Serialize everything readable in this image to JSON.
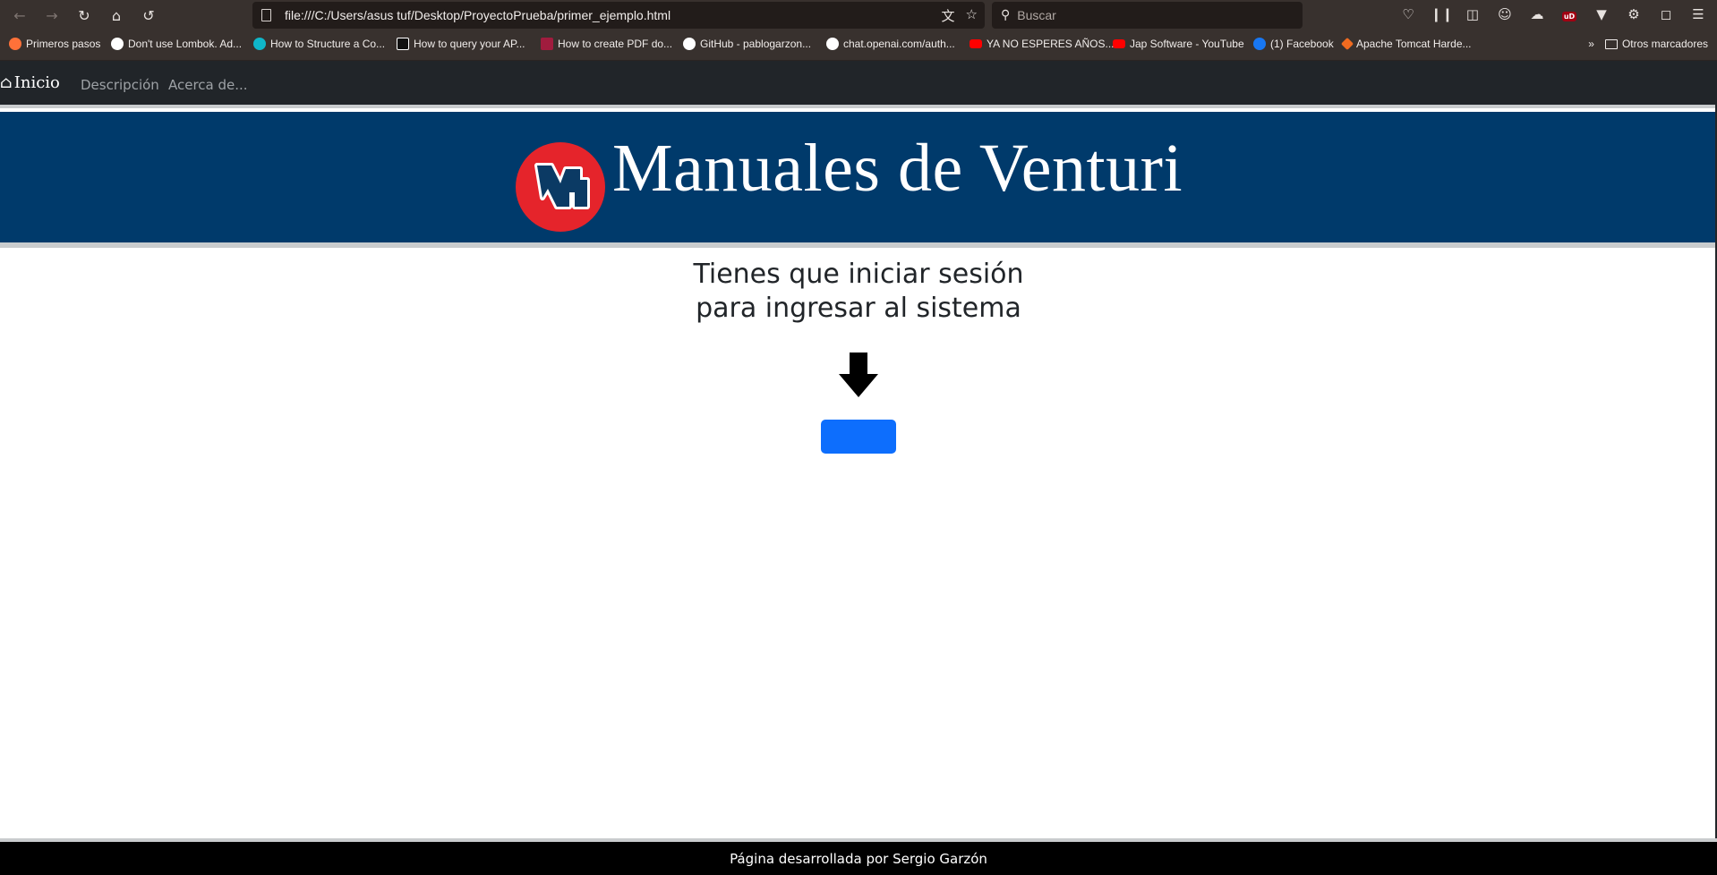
{
  "browser": {
    "url": "file:///C:/Users/asus tuf/Desktop/ProyectoPrueba/primer_ejemplo.html",
    "search_placeholder": "Buscar",
    "bookmarks": [
      {
        "label": "Primeros pasos",
        "color": "#ff7139"
      },
      {
        "label": "Don't use Lombok. Ad...",
        "color": "#ffffff"
      },
      {
        "label": "How to Structure a Co...",
        "color": "#0fb6c9"
      },
      {
        "label": "How to query your AP...",
        "color": "#000000"
      },
      {
        "label": "How to create PDF do...",
        "color": "#a01c3e"
      },
      {
        "label": "GitHub - pablogarzon...",
        "color": "#ffffff"
      },
      {
        "label": "chat.openai.com/auth...",
        "color": "#ffffff"
      },
      {
        "label": "YA NO ESPERES AÑOS...",
        "color": "#ff0000"
      },
      {
        "label": "Jap Software - YouTube",
        "color": "#ff0000"
      },
      {
        "label": "(1) Facebook",
        "color": "#1877f2"
      },
      {
        "label": "Apache Tomcat Harde...",
        "color": "#f06b20"
      }
    ],
    "other_bookmarks": "Otros marcadores"
  },
  "navbar": {
    "brand": "Inicio",
    "links": [
      "Descripción",
      "Acerca de..."
    ]
  },
  "banner": {
    "title": "Manuales de Venturi",
    "logo_color": "#e5242b",
    "background": "#003a6b"
  },
  "main": {
    "line1": "Tienes que iniciar sesión",
    "line2": "para ingresar al sistema",
    "button_color": "#0d6efd"
  },
  "footer": {
    "text": "Página desarrollada por Sergio Garzón"
  }
}
